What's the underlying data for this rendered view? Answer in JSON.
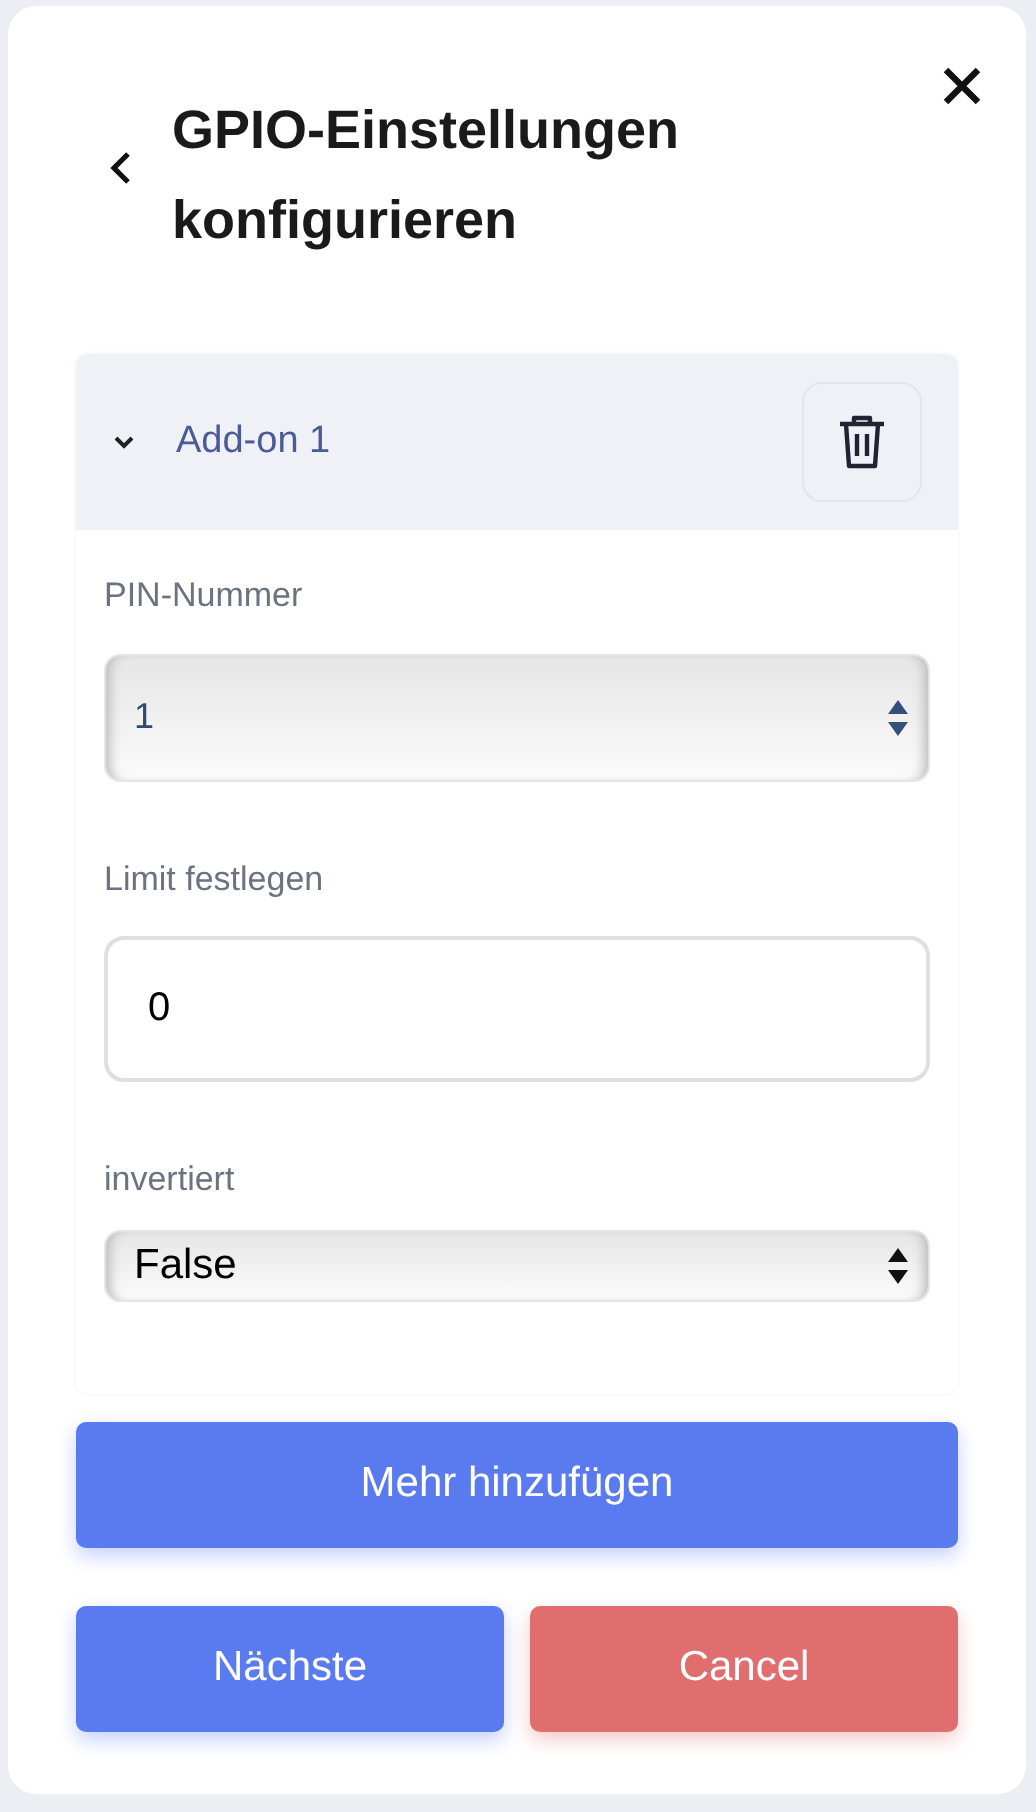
{
  "dialog": {
    "title": "GPIO-Einstellungen konfigurieren"
  },
  "addons": [
    {
      "title": "Add-on 1",
      "expanded": true,
      "fields": [
        {
          "kind": "select",
          "label": "PIN-Nummer",
          "value": "1"
        },
        {
          "kind": "input",
          "label": "Limit festlegen",
          "value": "0"
        },
        {
          "kind": "boolselect",
          "label": "invertiert",
          "value": "False"
        }
      ]
    }
  ],
  "add_button": "Mehr hinzufügen",
  "buttons": [
    {
      "label": "Nächste",
      "kind": "primary"
    },
    {
      "label": "Cancel",
      "kind": "danger"
    }
  ]
}
